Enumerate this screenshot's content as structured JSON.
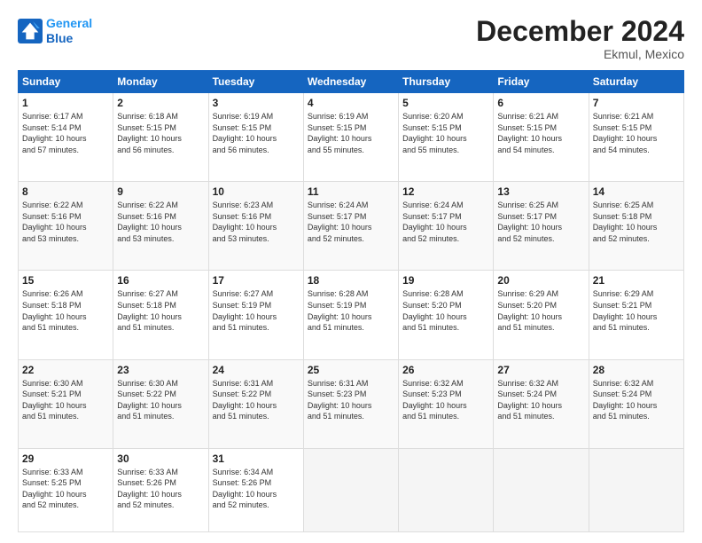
{
  "logo": {
    "line1": "General",
    "line2": "Blue"
  },
  "title": "December 2024",
  "subtitle": "Ekmul, Mexico",
  "weekdays": [
    "Sunday",
    "Monday",
    "Tuesday",
    "Wednesday",
    "Thursday",
    "Friday",
    "Saturday"
  ],
  "weeks": [
    [
      {
        "day": "1",
        "info": "Sunrise: 6:17 AM\nSunset: 5:14 PM\nDaylight: 10 hours\nand 57 minutes."
      },
      {
        "day": "2",
        "info": "Sunrise: 6:18 AM\nSunset: 5:15 PM\nDaylight: 10 hours\nand 56 minutes."
      },
      {
        "day": "3",
        "info": "Sunrise: 6:19 AM\nSunset: 5:15 PM\nDaylight: 10 hours\nand 56 minutes."
      },
      {
        "day": "4",
        "info": "Sunrise: 6:19 AM\nSunset: 5:15 PM\nDaylight: 10 hours\nand 55 minutes."
      },
      {
        "day": "5",
        "info": "Sunrise: 6:20 AM\nSunset: 5:15 PM\nDaylight: 10 hours\nand 55 minutes."
      },
      {
        "day": "6",
        "info": "Sunrise: 6:21 AM\nSunset: 5:15 PM\nDaylight: 10 hours\nand 54 minutes."
      },
      {
        "day": "7",
        "info": "Sunrise: 6:21 AM\nSunset: 5:15 PM\nDaylight: 10 hours\nand 54 minutes."
      }
    ],
    [
      {
        "day": "8",
        "info": "Sunrise: 6:22 AM\nSunset: 5:16 PM\nDaylight: 10 hours\nand 53 minutes."
      },
      {
        "day": "9",
        "info": "Sunrise: 6:22 AM\nSunset: 5:16 PM\nDaylight: 10 hours\nand 53 minutes."
      },
      {
        "day": "10",
        "info": "Sunrise: 6:23 AM\nSunset: 5:16 PM\nDaylight: 10 hours\nand 53 minutes."
      },
      {
        "day": "11",
        "info": "Sunrise: 6:24 AM\nSunset: 5:17 PM\nDaylight: 10 hours\nand 52 minutes."
      },
      {
        "day": "12",
        "info": "Sunrise: 6:24 AM\nSunset: 5:17 PM\nDaylight: 10 hours\nand 52 minutes."
      },
      {
        "day": "13",
        "info": "Sunrise: 6:25 AM\nSunset: 5:17 PM\nDaylight: 10 hours\nand 52 minutes."
      },
      {
        "day": "14",
        "info": "Sunrise: 6:25 AM\nSunset: 5:18 PM\nDaylight: 10 hours\nand 52 minutes."
      }
    ],
    [
      {
        "day": "15",
        "info": "Sunrise: 6:26 AM\nSunset: 5:18 PM\nDaylight: 10 hours\nand 51 minutes."
      },
      {
        "day": "16",
        "info": "Sunrise: 6:27 AM\nSunset: 5:18 PM\nDaylight: 10 hours\nand 51 minutes."
      },
      {
        "day": "17",
        "info": "Sunrise: 6:27 AM\nSunset: 5:19 PM\nDaylight: 10 hours\nand 51 minutes."
      },
      {
        "day": "18",
        "info": "Sunrise: 6:28 AM\nSunset: 5:19 PM\nDaylight: 10 hours\nand 51 minutes."
      },
      {
        "day": "19",
        "info": "Sunrise: 6:28 AM\nSunset: 5:20 PM\nDaylight: 10 hours\nand 51 minutes."
      },
      {
        "day": "20",
        "info": "Sunrise: 6:29 AM\nSunset: 5:20 PM\nDaylight: 10 hours\nand 51 minutes."
      },
      {
        "day": "21",
        "info": "Sunrise: 6:29 AM\nSunset: 5:21 PM\nDaylight: 10 hours\nand 51 minutes."
      }
    ],
    [
      {
        "day": "22",
        "info": "Sunrise: 6:30 AM\nSunset: 5:21 PM\nDaylight: 10 hours\nand 51 minutes."
      },
      {
        "day": "23",
        "info": "Sunrise: 6:30 AM\nSunset: 5:22 PM\nDaylight: 10 hours\nand 51 minutes."
      },
      {
        "day": "24",
        "info": "Sunrise: 6:31 AM\nSunset: 5:22 PM\nDaylight: 10 hours\nand 51 minutes."
      },
      {
        "day": "25",
        "info": "Sunrise: 6:31 AM\nSunset: 5:23 PM\nDaylight: 10 hours\nand 51 minutes."
      },
      {
        "day": "26",
        "info": "Sunrise: 6:32 AM\nSunset: 5:23 PM\nDaylight: 10 hours\nand 51 minutes."
      },
      {
        "day": "27",
        "info": "Sunrise: 6:32 AM\nSunset: 5:24 PM\nDaylight: 10 hours\nand 51 minutes."
      },
      {
        "day": "28",
        "info": "Sunrise: 6:32 AM\nSunset: 5:24 PM\nDaylight: 10 hours\nand 51 minutes."
      }
    ],
    [
      {
        "day": "29",
        "info": "Sunrise: 6:33 AM\nSunset: 5:25 PM\nDaylight: 10 hours\nand 52 minutes."
      },
      {
        "day": "30",
        "info": "Sunrise: 6:33 AM\nSunset: 5:26 PM\nDaylight: 10 hours\nand 52 minutes."
      },
      {
        "day": "31",
        "info": "Sunrise: 6:34 AM\nSunset: 5:26 PM\nDaylight: 10 hours\nand 52 minutes."
      },
      null,
      null,
      null,
      null
    ]
  ]
}
